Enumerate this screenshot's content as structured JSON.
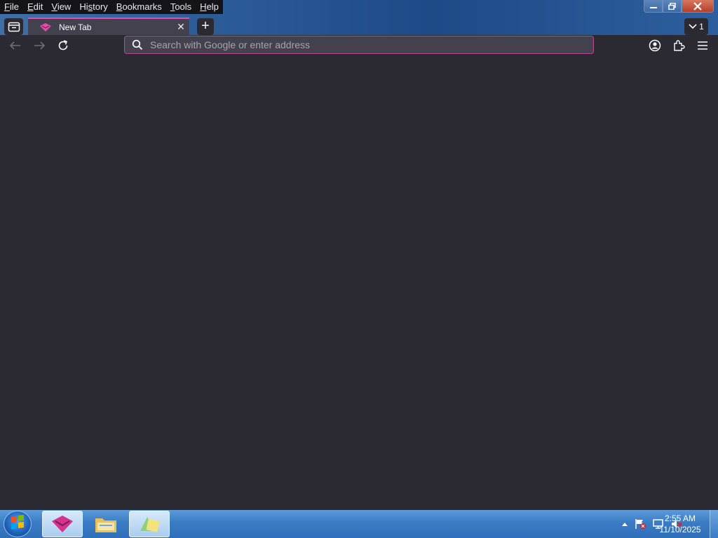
{
  "menu": {
    "items": [
      {
        "label_u": "F",
        "label_rest": "ile"
      },
      {
        "label_u": "E",
        "label_rest": "dit"
      },
      {
        "label_u": "V",
        "label_rest": "iew"
      },
      {
        "label_pre": "Hi",
        "label_u": "s",
        "label_rest": "tory"
      },
      {
        "label_u": "B",
        "label_rest": "ookmarks"
      },
      {
        "label_u": "T",
        "label_rest": "ools"
      },
      {
        "label_u": "H",
        "label_rest": "elp"
      }
    ]
  },
  "tabs": {
    "active_title": "New Tab",
    "close_glyph": "✕",
    "new_tab_glyph": "+",
    "list_count": "1"
  },
  "urlbar": {
    "placeholder": "Search with Google or enter address",
    "value": ""
  },
  "taskbar": {
    "time": "2:55 AM",
    "date": "11/10/2025"
  },
  "colors": {
    "accent": "#e24fa8",
    "background": "#2b2a33",
    "toolbar_field": "#42414d"
  }
}
